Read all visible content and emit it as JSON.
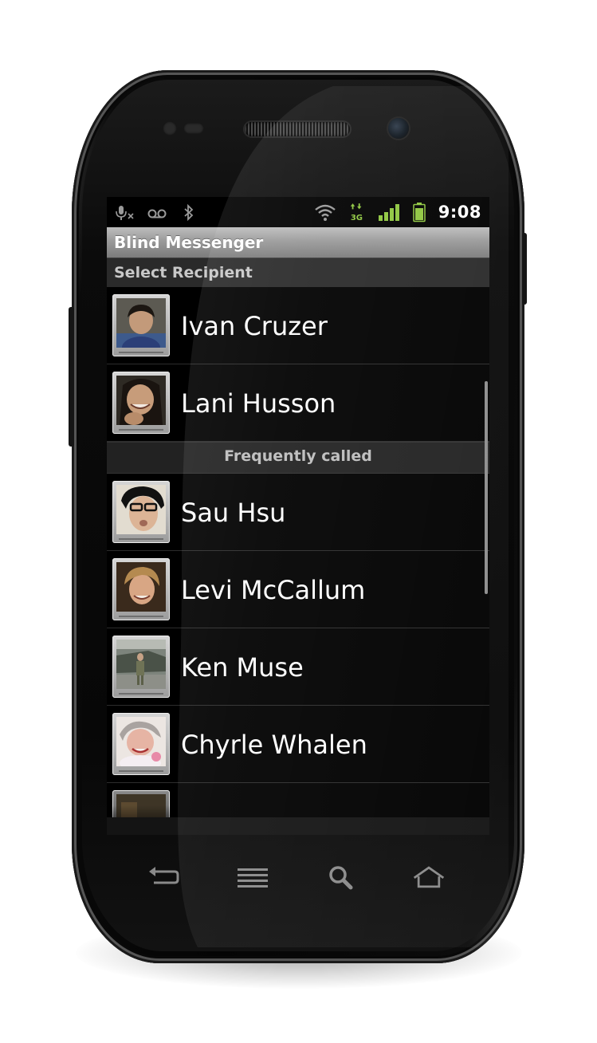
{
  "status_bar": {
    "time": "9:08",
    "left_icons": [
      "mic-muted-icon",
      "voicemail-icon",
      "bluetooth-icon"
    ],
    "right_icons": [
      "wifi-icon",
      "network-3g-icon",
      "signal-icon",
      "battery-icon"
    ],
    "accent_color": "#8ec63f"
  },
  "app": {
    "title": "Blind Messenger",
    "subtitle": "Select Recipient"
  },
  "contacts_top": [
    {
      "name": "Ivan Cruzer"
    },
    {
      "name": "Lani Husson"
    }
  ],
  "section_label": "Frequently called",
  "contacts_frequent": [
    {
      "name": "Sau Hsu"
    },
    {
      "name": "Levi McCallum"
    },
    {
      "name": "Ken Muse"
    },
    {
      "name": "Chyrle Whalen"
    }
  ],
  "nav_buttons": [
    "back-icon",
    "menu-icon",
    "search-icon",
    "home-icon"
  ]
}
